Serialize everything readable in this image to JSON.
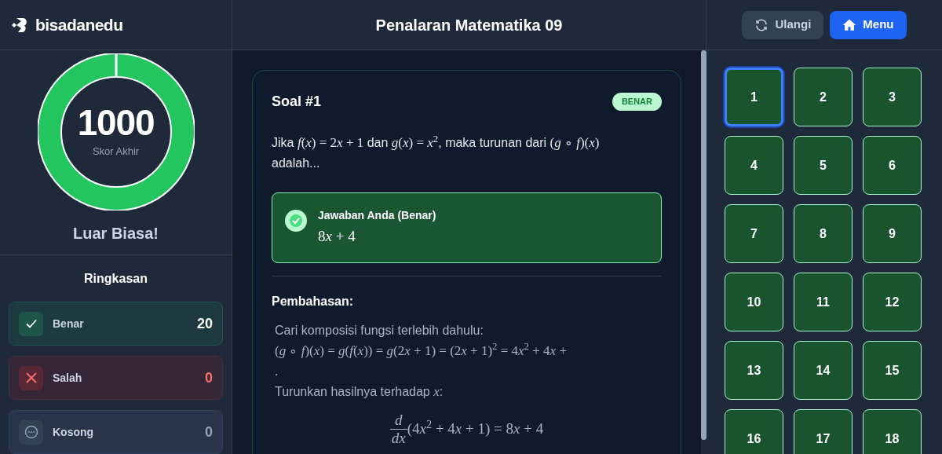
{
  "header": {
    "brand": "bisadanedu",
    "title": "Penalaran Matematika 09",
    "buttons": [
      {
        "kind": "retry",
        "label": "Ulangi"
      },
      {
        "kind": "menu",
        "label": "Menu"
      }
    ]
  },
  "score": {
    "value": "1000",
    "caption": "Skor Akhir",
    "verdict": "Luar Biasa!"
  },
  "summary": {
    "title": "Ringkasan",
    "items": [
      {
        "kind": "correct",
        "label": "Benar",
        "count": "20"
      },
      {
        "kind": "wrong",
        "label": "Salah",
        "count": "0"
      },
      {
        "kind": "empty",
        "label": "Kosong",
        "count": "0"
      }
    ]
  },
  "question": {
    "title": "Soal #1",
    "badge": "BENAR",
    "text": [
      {
        "kind": "text",
        "text": "Jika "
      },
      {
        "kind": "math",
        "text": "f(x) = 2x + 1"
      },
      {
        "kind": "text",
        "text": " dan "
      },
      {
        "kind": "math",
        "text": "g(x) = x$^{2}$"
      },
      {
        "kind": "text",
        "text": ", maka turunan dari "
      },
      {
        "kind": "math",
        "text": "(g ∘ f)(x)"
      },
      {
        "kind": "text",
        "text": " adalah..."
      }
    ],
    "answer": {
      "label": "Jawaban Anda (Benar)",
      "value": "8x + 4"
    },
    "explanation_title": "Pembahasan:",
    "explanation": [
      [
        {
          "kind": "text",
          "text": "Cari komposisi fungsi terlebih dahulu:"
        }
      ],
      [
        {
          "kind": "math",
          "text": "(g ∘ f)(x) = g(f(x)) = g(2x + 1) = (2x + 1)$^{2}$ = 4x$^{2}$ + 4x +"
        }
      ],
      [
        {
          "kind": "math",
          "text": "."
        }
      ],
      [
        {
          "kind": "text",
          "text": "Turunkan hasilnya terhadap "
        },
        {
          "kind": "math",
          "text": "x"
        },
        {
          "kind": "text",
          "text": ":"
        }
      ]
    ],
    "formula": {
      "numerator": "d",
      "denominator": "dx",
      "rest": "(4x$^{2}$ + 4x + 1) = 8x + 4"
    }
  },
  "grid": [
    {
      "label": "1",
      "selected": true
    },
    {
      "label": "2",
      "selected": false
    },
    {
      "label": "3",
      "selected": false
    },
    {
      "label": "4",
      "selected": false
    },
    {
      "label": "5",
      "selected": false
    },
    {
      "label": "6",
      "selected": false
    },
    {
      "label": "7",
      "selected": false
    },
    {
      "label": "8",
      "selected": false
    },
    {
      "label": "9",
      "selected": false
    },
    {
      "label": "10",
      "selected": false
    },
    {
      "label": "11",
      "selected": false
    },
    {
      "label": "12",
      "selected": false
    },
    {
      "label": "13",
      "selected": false
    },
    {
      "label": "14",
      "selected": false
    },
    {
      "label": "15",
      "selected": false
    },
    {
      "label": "16",
      "selected": false
    },
    {
      "label": "17",
      "selected": false
    },
    {
      "label": "18",
      "selected": false
    }
  ]
}
